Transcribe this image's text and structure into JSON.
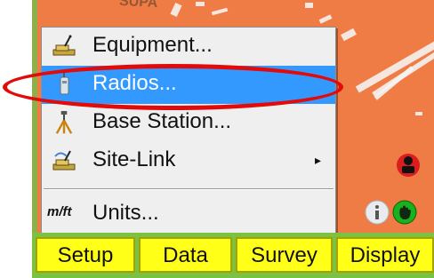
{
  "map": {
    "top_text": "SUPA"
  },
  "menu": {
    "items": [
      {
        "label": "Equipment...",
        "icon": "equipment-icon"
      },
      {
        "label": "Radios...",
        "icon": "radio-icon"
      },
      {
        "label": "Base Station...",
        "icon": "base-station-icon"
      },
      {
        "label": "Site-Link",
        "icon": "site-link-icon",
        "submenu_arrow": "▸"
      },
      {
        "label": "Units...",
        "icon_text": "m/ft"
      }
    ]
  },
  "status_icons": [
    "red-radio-icon",
    "info-icon",
    "green-hand-icon"
  ],
  "tabs": [
    "Setup",
    "Data",
    "Survey",
    "Display"
  ],
  "colors": {
    "map_orange": "#f07c45",
    "menu_selected": "#3399ff",
    "highlight_red": "#e30a0a",
    "tab_yellow": "#ffff17",
    "bottom_green": "#7cc242"
  }
}
